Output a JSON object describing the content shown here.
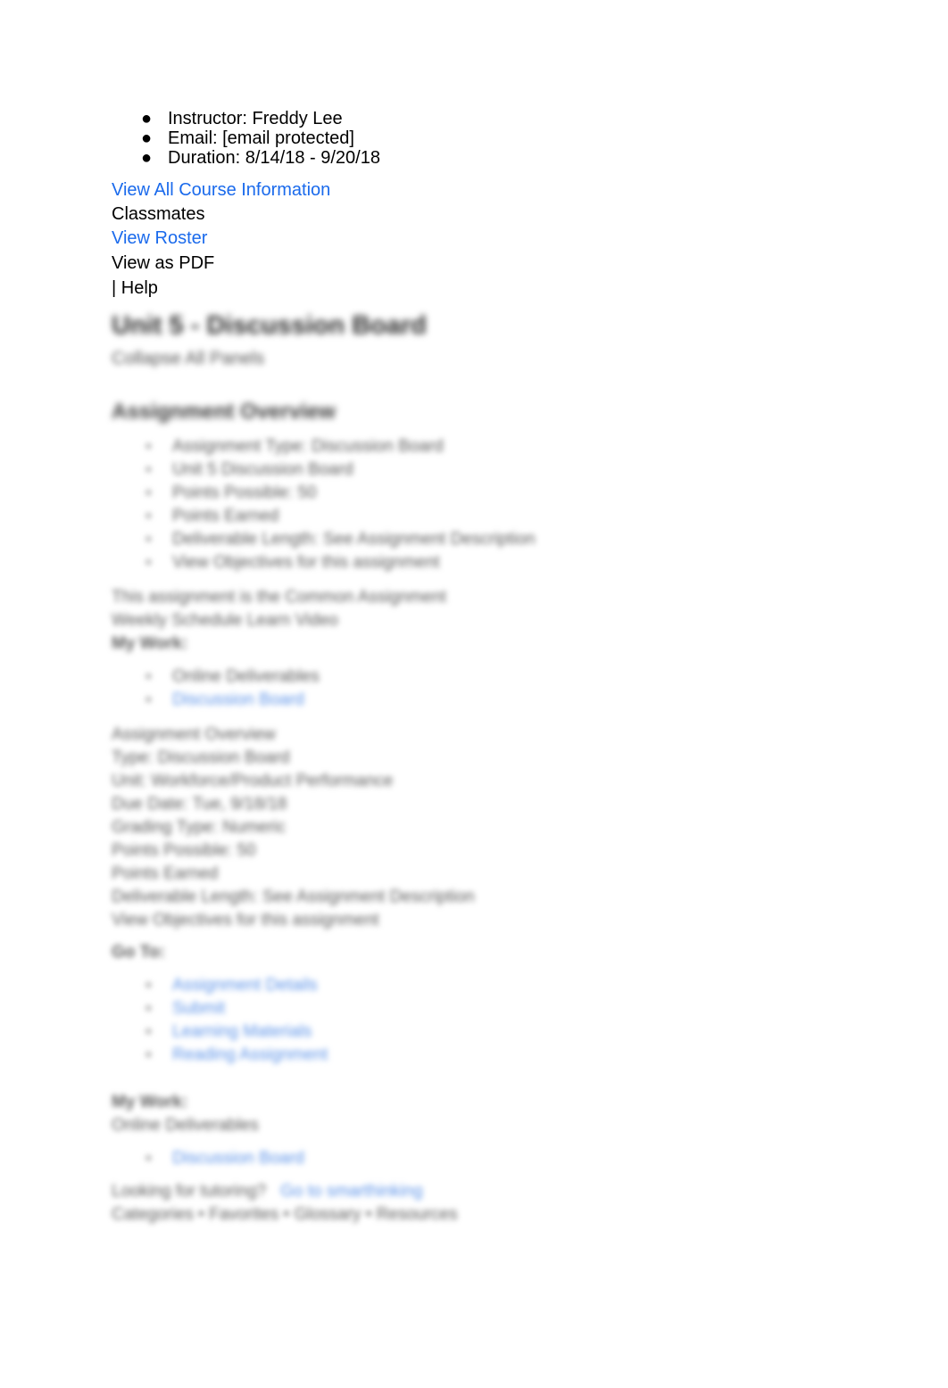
{
  "page": {
    "background_color": "#ffffff",
    "text_color": "#000000",
    "link_color": "#1a6aec",
    "blurred_text_color": "#5a5a5a",
    "blurred_link_color": "#5b92e8"
  },
  "course_meta": {
    "bullet_glyph": "●",
    "items": [
      {
        "label": "Instructor: Freddy Lee"
      },
      {
        "label": "Email: [email protected]"
      },
      {
        "label": "Duration: 8/14/18 - 9/20/18"
      }
    ]
  },
  "links": {
    "view_all_course_information": "View All Course Information",
    "view_roster": "View Roster"
  },
  "labels": {
    "classmates": "Classmates",
    "view_as_pdf": "View as PDF",
    "help": "| Help"
  },
  "assignment": {
    "title": "Unit 5 - Discussion Board",
    "subtitle": "Collapse All Panels",
    "overview_heading": "Assignment Overview",
    "overview_items": [
      {
        "text": "Assignment Type: Discussion Board",
        "is_link": false
      },
      {
        "text": "Unit 5 Discussion Board",
        "is_link": false
      },
      {
        "text": "Points Possible: 50",
        "is_link": false
      },
      {
        "text": "Points Earned",
        "is_link": false
      },
      {
        "text": "Deliverable Length: See Assignment Description",
        "is_link": false
      },
      {
        "text": "View Objectives for this assignment",
        "is_link": false
      }
    ],
    "paragraphs": [
      "This assignment is the Common Assignment",
      "Weekly Schedule Learn Video",
      "My Work:"
    ],
    "work_items": [
      {
        "text": "Online Deliverables",
        "is_link": false
      },
      {
        "text": "Discussion Board",
        "is_link": true
      }
    ],
    "details_heading": "Assignment Overview",
    "detail_lines": [
      "Type: Discussion Board",
      "Unit: Workforce/Product Performance",
      "Due Date: Tue, 9/18/18",
      "Grading Type: Numeric",
      "Points Possible: 50",
      "Points Earned",
      "Deliverable Length: See Assignment Description",
      "View Objectives for this assignment"
    ],
    "resources_label": "Go To:",
    "resources": [
      {
        "text": "Assignment Details",
        "is_link": true
      },
      {
        "text": "Submit",
        "is_link": true
      },
      {
        "text": "Learning Materials",
        "is_link": true
      },
      {
        "text": "Reading Assignment",
        "is_link": true
      }
    ],
    "my_work_label": "My Work:",
    "online_deliverables_label": "Online Deliverables",
    "online_deliverables": [
      {
        "text": "Discussion Board",
        "is_link": true
      }
    ],
    "tutoring_prompt": "Looking for tutoring?",
    "tutoring_link": "Go to smarthinking",
    "footer_items": [
      "Categories",
      "Favorites",
      "Glossary",
      "Resources"
    ],
    "footer_separator": "•"
  }
}
